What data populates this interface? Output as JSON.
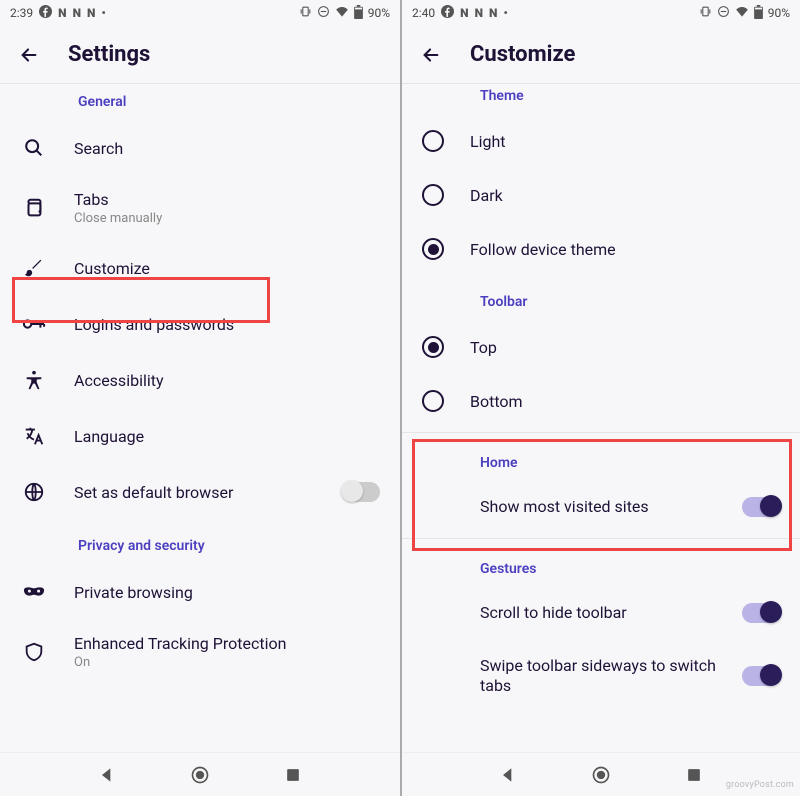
{
  "left": {
    "status": {
      "time": "2:39",
      "battery": "90%"
    },
    "title": "Settings",
    "sections": {
      "general": {
        "header": "General",
        "search": "Search",
        "tabs": "Tabs",
        "tabs_sub": "Close manually",
        "customize": "Customize",
        "logins": "Logins and passwords",
        "accessibility": "Accessibility",
        "language": "Language",
        "default_browser": "Set as default browser"
      },
      "privacy": {
        "header": "Privacy and security",
        "private_browsing": "Private browsing",
        "etp": "Enhanced Tracking Protection",
        "etp_sub": "On"
      }
    }
  },
  "right": {
    "status": {
      "time": "2:40",
      "battery": "90%"
    },
    "title": "Customize",
    "theme": {
      "header": "Theme",
      "light": "Light",
      "dark": "Dark",
      "follow": "Follow device theme"
    },
    "toolbar": {
      "header": "Toolbar",
      "top": "Top",
      "bottom": "Bottom"
    },
    "home": {
      "header": "Home",
      "show_most_visited": "Show most visited sites"
    },
    "gestures": {
      "header": "Gestures",
      "scroll_hide": "Scroll to hide toolbar",
      "swipe_tabs": "Swipe toolbar sideways to switch tabs"
    }
  },
  "watermark": "groovyPost.com"
}
